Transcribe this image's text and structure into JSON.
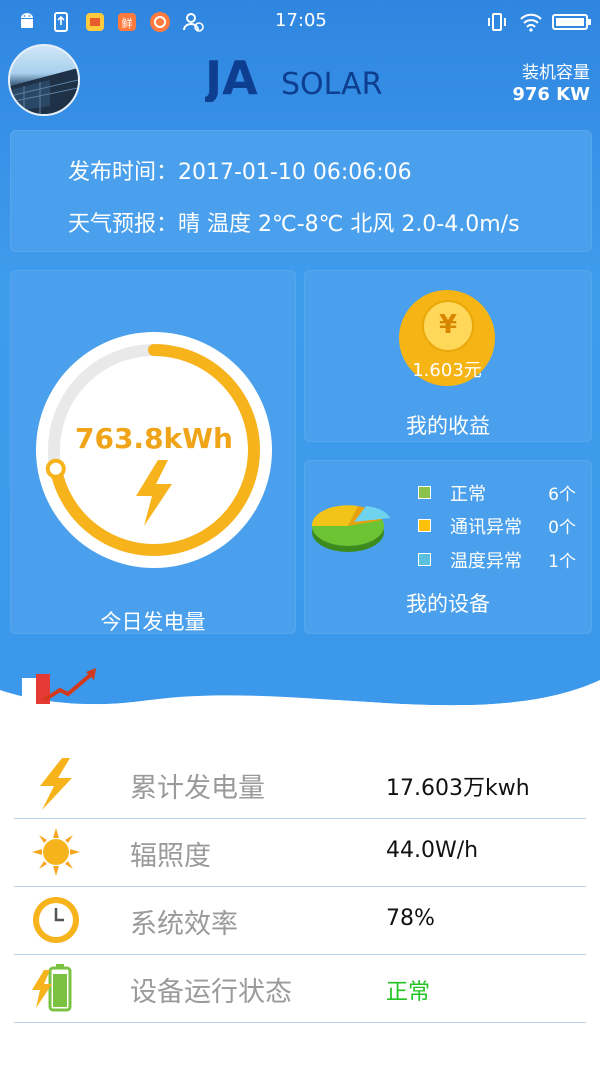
{
  "status_bar": {
    "time": "17:05"
  },
  "header": {
    "logo_ja": "JA",
    "logo_solar": "SOLAR",
    "capacity_label": "装机容量",
    "capacity_value": "976 KW"
  },
  "info": {
    "publish_time": "发布时间：2017-01-10 06:06:06",
    "weather": "天气预报：晴 温度 2℃-8℃ 北风 2.0-4.0m/s"
  },
  "generation": {
    "value": "763.8kWh",
    "progress": 0.72,
    "label": "今日发电量"
  },
  "income": {
    "symbol": "¥",
    "amount": "1.603元",
    "label": "我的收益"
  },
  "devices": {
    "label": "我的设备",
    "legend": [
      {
        "name": "正常",
        "count": "6个",
        "color": "#8bc34a"
      },
      {
        "name": "通讯异常",
        "count": "0个",
        "color": "#ffc107"
      },
      {
        "name": "温度异常",
        "count": "1个",
        "color": "#5bc0de"
      }
    ]
  },
  "stats": [
    {
      "icon": "lightning-icon",
      "label": "累计发电量",
      "value": "17.603万kwh"
    },
    {
      "icon": "sun-icon",
      "label": "辐照度",
      "value": "44.0W/h"
    },
    {
      "icon": "clock-icon",
      "label": "系统效率",
      "value": "78%"
    },
    {
      "icon": "battery-icon",
      "label": "设备运行状态",
      "value": "正常"
    }
  ],
  "colors": {
    "accent": "#3c98ea",
    "card": "#4aa0ec",
    "gold": "#f0a417",
    "ok": "#22c322"
  }
}
